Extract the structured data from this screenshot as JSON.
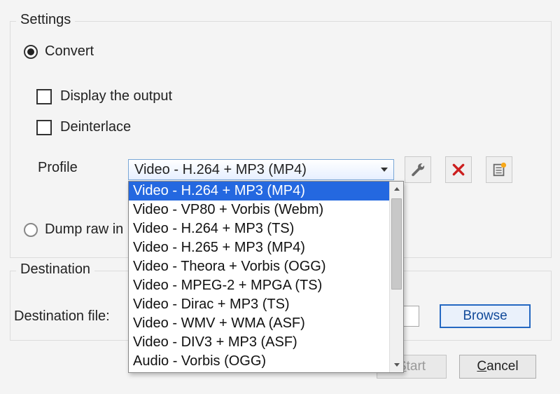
{
  "settings": {
    "legend": "Settings",
    "convert_label": "Convert",
    "display_output_label": "Display the output",
    "deinterlace_label": "Deinterlace",
    "profile_label": "Profile",
    "dump_raw_label": "Dump raw in",
    "profile_selected": "Video - H.264 + MP3 (MP4)",
    "profile_options": [
      "Video - H.264 + MP3 (MP4)",
      "Video - VP80 + Vorbis (Webm)",
      "Video - H.264 + MP3 (TS)",
      "Video - H.265 + MP3 (MP4)",
      "Video - Theora + Vorbis (OGG)",
      "Video - MPEG-2 + MPGA (TS)",
      "Video - Dirac + MP3 (TS)",
      "Video - WMV + WMA (ASF)",
      "Video - DIV3 + MP3 (ASF)",
      "Audio - Vorbis (OGG)"
    ],
    "icon_buttons": {
      "wrench": "edit-profile",
      "delete": "delete-profile",
      "new": "new-profile"
    }
  },
  "destination": {
    "legend": "Destination",
    "file_label": "Destination file:",
    "file_value": "",
    "browse_label": "Browse"
  },
  "footer": {
    "start_label": "Start",
    "cancel_prefix": "C",
    "cancel_rest": "ancel"
  }
}
